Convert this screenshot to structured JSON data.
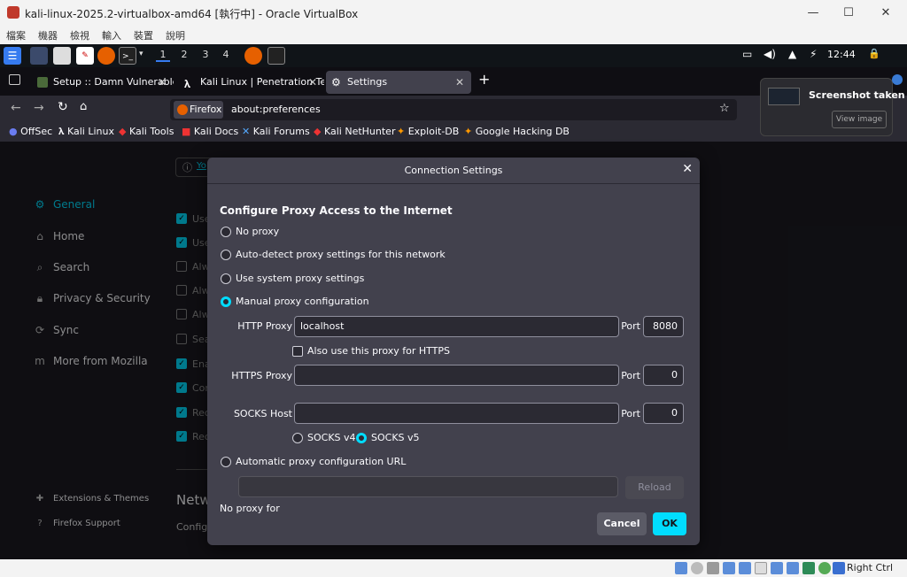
{
  "window": {
    "title": "kali-linux-2025.2-virtualbox-amd64 [執行中] - Oracle VirtualBox",
    "minimize": "—",
    "maximize": "☐",
    "close": "✕"
  },
  "vbox_menu": [
    "檔案",
    "機器",
    "檢視",
    "輸入",
    "裝置",
    "說明"
  ],
  "panel": {
    "workspaces": [
      "1",
      "2",
      "3",
      "4"
    ],
    "clock": "12:44"
  },
  "tabs": [
    {
      "label": "Setup :: Damn Vulnerable"
    },
    {
      "label": "Kali Linux | Penetration Te"
    },
    {
      "label": "Settings"
    }
  ],
  "new_tab": "+",
  "url": {
    "identity": "Firefox",
    "address": "about:preferences"
  },
  "bookmarks": [
    "OffSec",
    "Kali Linux",
    "Kali Tools",
    "Kali Docs",
    "Kali Forums",
    "Kali NetHunter",
    "Exploit-DB",
    "Google Hacking DB"
  ],
  "sidebar": {
    "items": [
      "General",
      "Home",
      "Search",
      "Privacy & Security",
      "Sync",
      "More from Mozilla"
    ],
    "footer": [
      "Extensions & Themes",
      "Firefox Support"
    ]
  },
  "background": {
    "snippets": [
      "Use",
      "Use",
      "Alw",
      "Alw",
      "Alw",
      "Sea",
      "Ena",
      "Cor",
      "Rec",
      "Rec"
    ],
    "network_heading": "Netw",
    "config": "Config",
    "info": "Yo"
  },
  "dialog": {
    "title": "Connection Settings",
    "heading": "Configure Proxy Access to the Internet",
    "options": {
      "no_proxy": "No proxy",
      "auto_detect": "Auto-detect proxy settings for this network",
      "system": "Use system proxy settings",
      "manual": "Manual proxy configuration",
      "auto_url": "Automatic proxy configuration URL"
    },
    "selected": "manual",
    "http_label": "HTTP Proxy",
    "http_value": "localhost",
    "port_label": "Port",
    "http_port": "8080",
    "also_https": "Also use this proxy for HTTPS",
    "https_label": "HTTPS Proxy",
    "https_value": "",
    "https_port": "0",
    "socks_label": "SOCKS Host",
    "socks_value": "",
    "socks_port": "0",
    "socks_v4": "SOCKS v4",
    "socks_v5": "SOCKS v5",
    "socks_selected": "v5",
    "reload": "Reload",
    "no_proxy_for": "No proxy for",
    "cancel": "Cancel",
    "ok": "OK"
  },
  "toast": {
    "title": "Screenshot taken",
    "action": "View image"
  },
  "statusbar": {
    "host_key": "Right Ctrl"
  },
  "colors": {
    "accent": "#00ddff",
    "dialog_bg": "#42414d",
    "page_bg": "#1c1b22"
  }
}
